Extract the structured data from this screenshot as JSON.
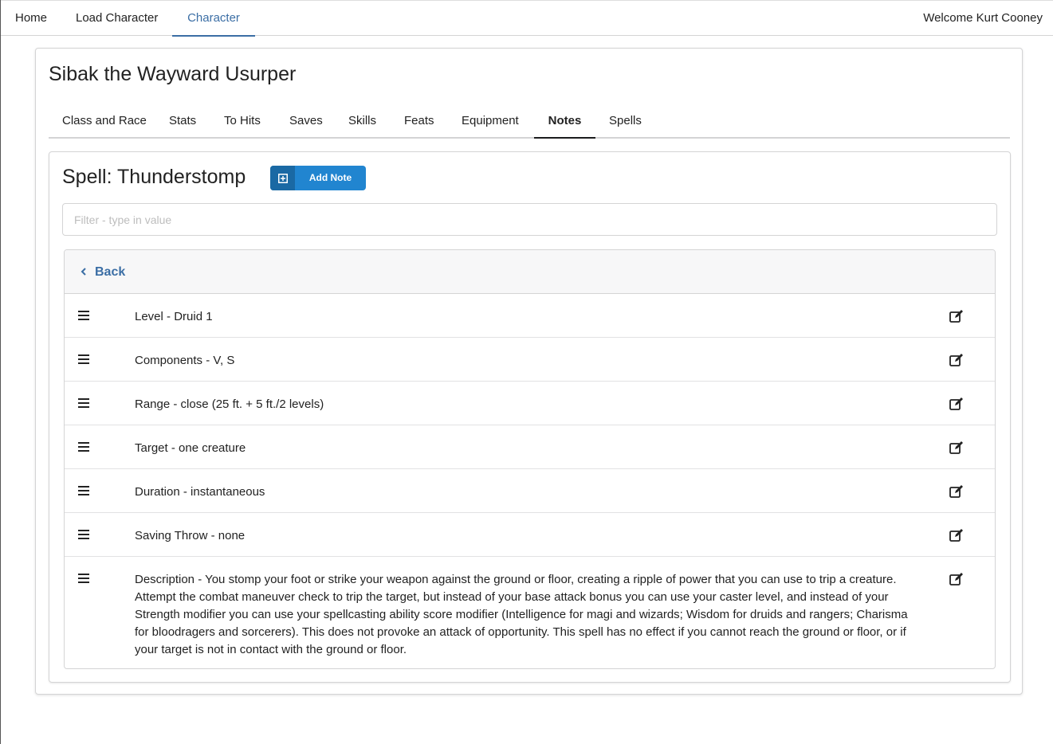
{
  "nav": {
    "items": [
      {
        "label": "Home"
      },
      {
        "label": "Load Character"
      },
      {
        "label": "Character"
      }
    ],
    "active": "Character",
    "welcome": "Welcome Kurt Cooney"
  },
  "character": {
    "name": "Sibak the Wayward Usurper"
  },
  "tabs": {
    "items": [
      {
        "label": "Class and Race"
      },
      {
        "label": "Stats"
      },
      {
        "label": "To Hits"
      },
      {
        "label": "Saves"
      },
      {
        "label": "Skills"
      },
      {
        "label": "Feats"
      },
      {
        "label": "Equipment"
      },
      {
        "label": "Notes"
      },
      {
        "label": "Spells"
      }
    ],
    "active": "Notes"
  },
  "notes": {
    "title": "Spell: Thunderstomp",
    "add_label": "Add Note",
    "filter_placeholder": "Filter - type in value",
    "back_label": "Back",
    "rows": [
      {
        "text": "Level - Druid 1"
      },
      {
        "text": "Components - V, S"
      },
      {
        "text": "Range - close (25 ft. + 5 ft./2 levels)"
      },
      {
        "text": "Target - one creature"
      },
      {
        "text": "Duration - instantaneous"
      },
      {
        "text": "Saving Throw - none"
      },
      {
        "text": "Description - You stomp your foot or strike your weapon against the ground or floor, creating a ripple of power that you can use to trip a creature. Attempt the combat maneuver check to trip the target, but instead of your base attack bonus you can use your caster level, and instead of your Strength modifier you can use your spellcasting ability score modifier (Intelligence for magi and wizards; Wisdom for druids and rangers; Charisma for bloodragers and sorcerers). This does not provoke an attack of opportunity. This spell has no effect if you cannot reach the ground or floor, or if your target is not in contact with the ground or floor."
      }
    ]
  },
  "colors": {
    "accent": "#3b6ea5",
    "button": "#2185d0",
    "button_icon_bg": "#1a69a4"
  },
  "icons": {
    "add": "plus-square-icon",
    "back": "chevron-left-icon",
    "drag": "bars-icon",
    "edit": "edit-icon"
  }
}
